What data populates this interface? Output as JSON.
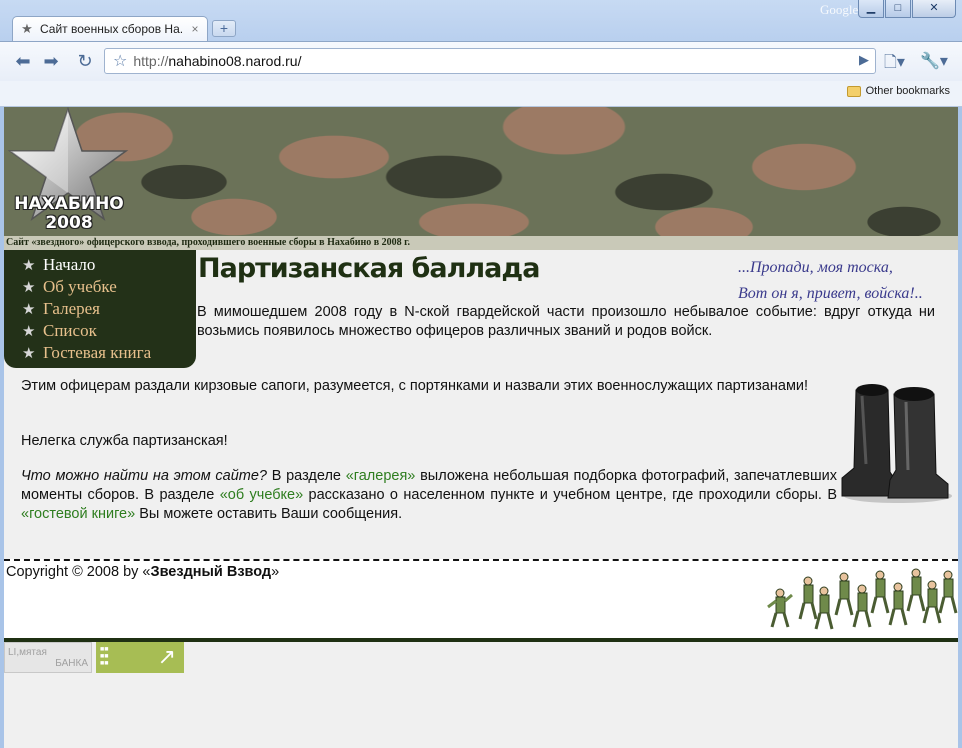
{
  "browser": {
    "tab_title": "Сайт военных сборов На...",
    "tab_close": "×",
    "new_tab": "+",
    "brand": "Google",
    "window_buttons": {
      "minimize": "▁",
      "maximize": "□",
      "close": "✕"
    },
    "url_prefix": "http://",
    "url_host": "nahabino08.narod.ru/",
    "bookmarks_other": "Other bookmarks",
    "icons": [
      "back-arrow-icon",
      "forward-arrow-icon",
      "reload-icon",
      "star-icon",
      "go-icon",
      "page-menu-icon",
      "wrench-icon",
      "folder-icon"
    ]
  },
  "banner": {
    "logo_line1": "НАХАБИНО",
    "logo_line2": "2008",
    "tagline": "Сайт «звездного» офицерского взвода, проходившего военные сборы в Нахабино в 2008 г."
  },
  "menu": {
    "items": [
      {
        "label": "Начало"
      },
      {
        "label": "Об учебке"
      },
      {
        "label": "Галерея"
      },
      {
        "label": "Список"
      },
      {
        "label": "Гостевая книга"
      }
    ]
  },
  "page": {
    "title": "Партизанская баллада",
    "epigraph_line1": "...Пропади, моя тоска,",
    "epigraph_line2": "Вот он я, привет, войска!..",
    "p1": "В мимошедшем 2008 году в N-ской гвардейской части произошло небывалое событие: вдруг откуда ни возьмись появилось множество офицеров различных званий и родов войск.",
    "p2": "Этим офицерам раздали кирзовые сапоги, разумеется, с портянками и назвали этих военнослужащих партизанами!",
    "p3": "Нелегка служба партизанская!",
    "p4_italic": "Что можно найти на этом сайте?",
    "p4_a": " В разделе ",
    "p4_link1": "«галерея»",
    "p4_b": " выложена небольшая подборка фотографий, запечатлевших моменты сборов. В разделе ",
    "p4_link2": "«об учебке»",
    "p4_c": " рассказано о населенном пункте и учебном центре, где проходили сборы. В ",
    "p4_link3": "«гостевой книге»",
    "p4_d": " Вы можете оставить Ваши сообщения."
  },
  "footer": {
    "copyright_prefix": "Copyright © 2008 by «",
    "copyright_name": "Звездный Взвод",
    "copyright_suffix": "»",
    "counter1_line1": "LI,мятая",
    "counter1_line2": "БАНКА"
  },
  "colors": {
    "menu_bg": "#233118",
    "menu_link": "#e7c08c",
    "title": "#1f3013",
    "epigraph": "#3a3a8c",
    "link_green": "#2e7d1f",
    "counter_green": "#a7bd54"
  }
}
